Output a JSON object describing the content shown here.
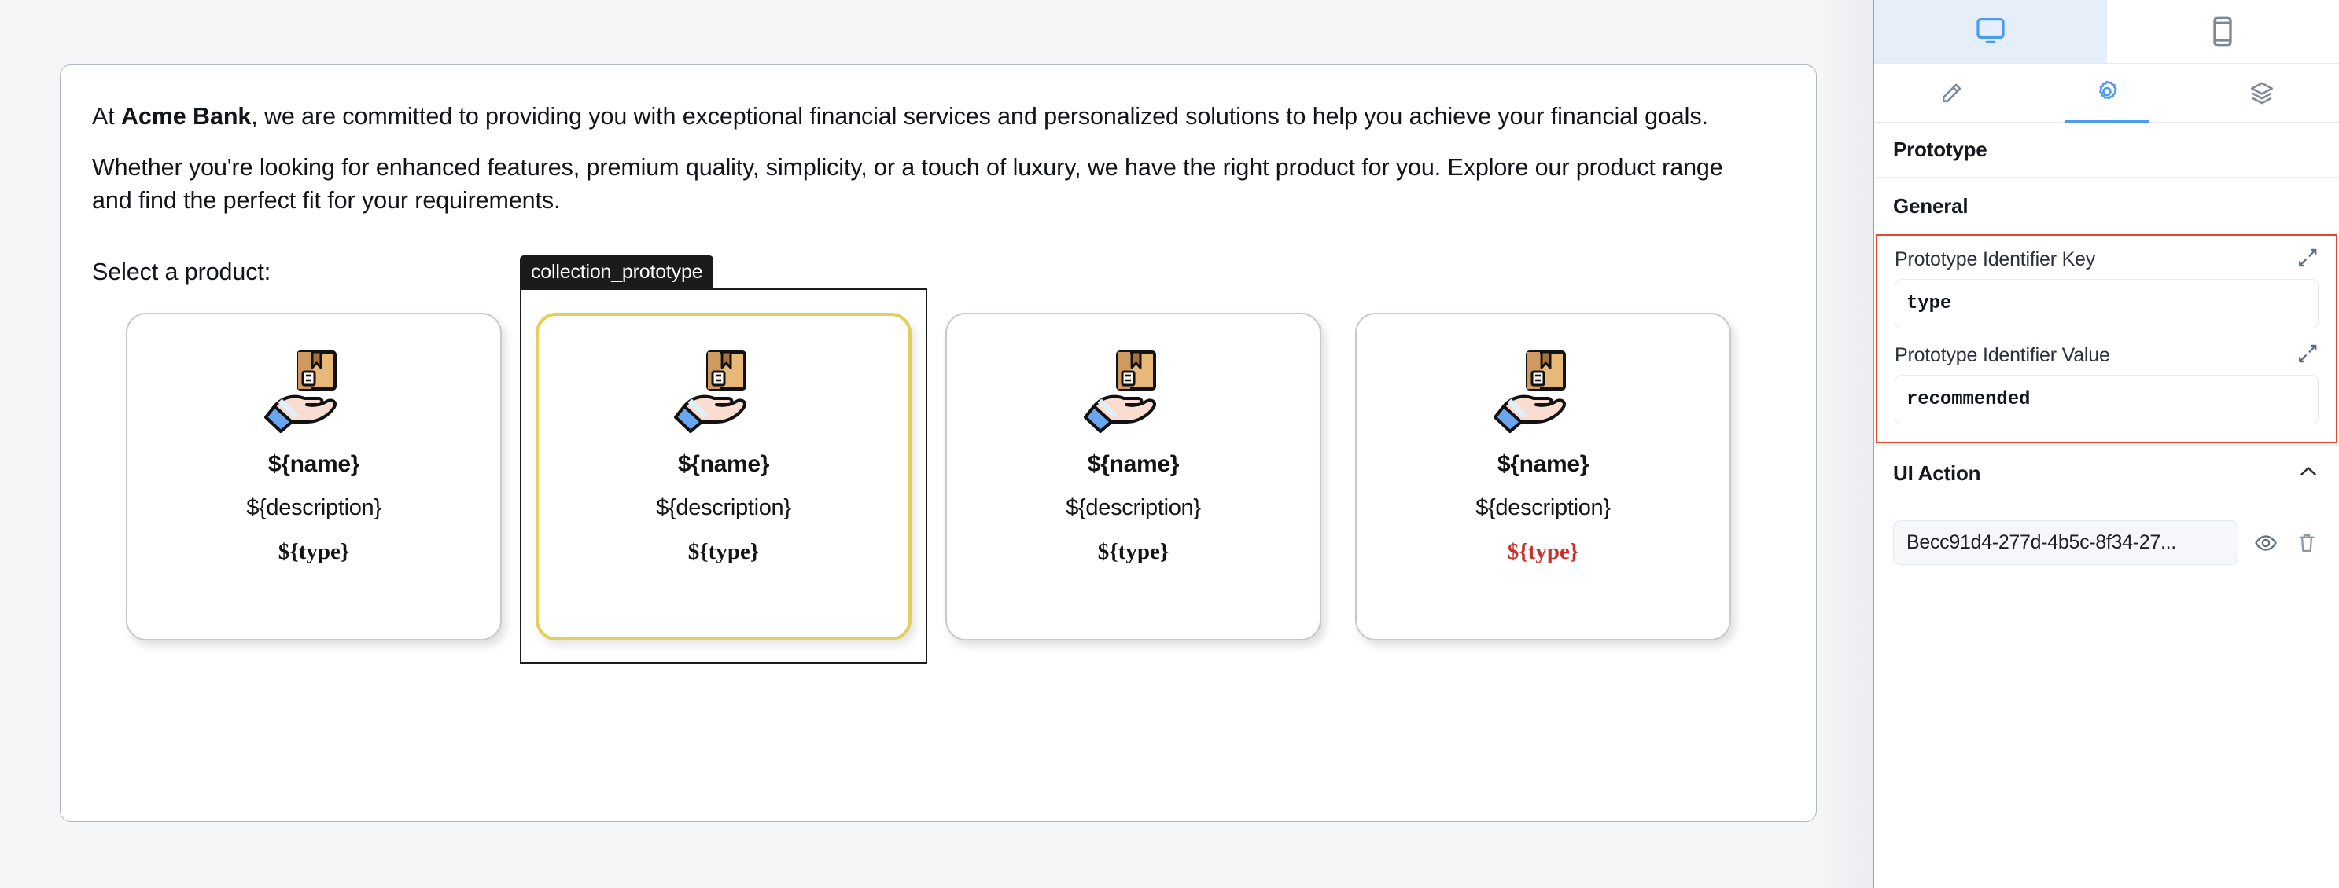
{
  "canvas": {
    "paragraphs": [
      {
        "prefix": "At ",
        "bold": "Acme Bank",
        "suffix": ", we are committed to providing you with exceptional financial services and personalized solutions to help you achieve your financial goals."
      },
      {
        "prefix": "",
        "bold": "",
        "suffix": "Whether you're looking for enhanced features, premium quality, simplicity, or a touch of luxury, we have the right product for you. Explore our product range and find the perfect fit for your requirements."
      }
    ],
    "para1_full": "At Acme Bank, we are committed to providing you with exceptional financial services and personalized solutions to help you achieve your financial goals.",
    "para1_prefix": "At ",
    "para1_bold": "Acme Bank",
    "para1_suffix": ", we are committed to providing you with exceptional financial services and personalized solutions to help you achieve your financial goals.",
    "para2": "Whether you're looking for enhanced features, premium quality, simplicity, or a touch of luxury, we have the right product for you. Explore our product range and find the perfect fit for your requirements.",
    "select_label": "Select a product:",
    "prototype_tag": "collection_prototype",
    "cards": [
      {
        "icon": "package-in-hand-icon",
        "name": "${name}",
        "description": "${description}",
        "type": "${type}",
        "type_color": "#141414",
        "selected": false
      },
      {
        "icon": "package-in-hand-icon",
        "name": "${name}",
        "description": "${description}",
        "type": "${type}",
        "type_color": "#141414",
        "selected": true
      },
      {
        "icon": "package-in-hand-icon",
        "name": "${name}",
        "description": "${description}",
        "type": "${type}",
        "type_color": "#141414",
        "selected": false
      },
      {
        "icon": "package-in-hand-icon",
        "name": "${name}",
        "description": "${description}",
        "type": "${type}",
        "type_color": "#c8312b",
        "selected": false
      }
    ]
  },
  "panel": {
    "device_tabs": [
      {
        "icon": "desktop-monitor-icon",
        "active": true
      },
      {
        "icon": "mobile-phone-icon",
        "active": false
      }
    ],
    "view_tabs": [
      {
        "icon": "pencil-icon",
        "active": false
      },
      {
        "icon": "gear-icon",
        "active": true
      },
      {
        "icon": "layers-icon",
        "active": false
      }
    ],
    "prototype_title": "Prototype",
    "general_title": "General",
    "fields": [
      {
        "label": "Prototype Identifier Key",
        "value": "type",
        "expand_icon": "expand-diagonal-icon"
      },
      {
        "label": "Prototype Identifier Value",
        "value": "recommended",
        "expand_icon": "expand-diagonal-icon"
      }
    ],
    "ui_action": {
      "title": "UI Action",
      "collapse_icon": "chevron-up-icon",
      "item_label": "Becc91d4-277d-4b5c-8f34-27...",
      "preview_icon": "eye-icon",
      "delete_icon": "trash-icon"
    },
    "colors": {
      "accent_blue": "#4d9bf0",
      "active_tab_bg": "#e6eefa",
      "highlight_red": "#e6472c",
      "selection_yellow": "#e3d05c",
      "danger_text": "#c8312b"
    }
  }
}
